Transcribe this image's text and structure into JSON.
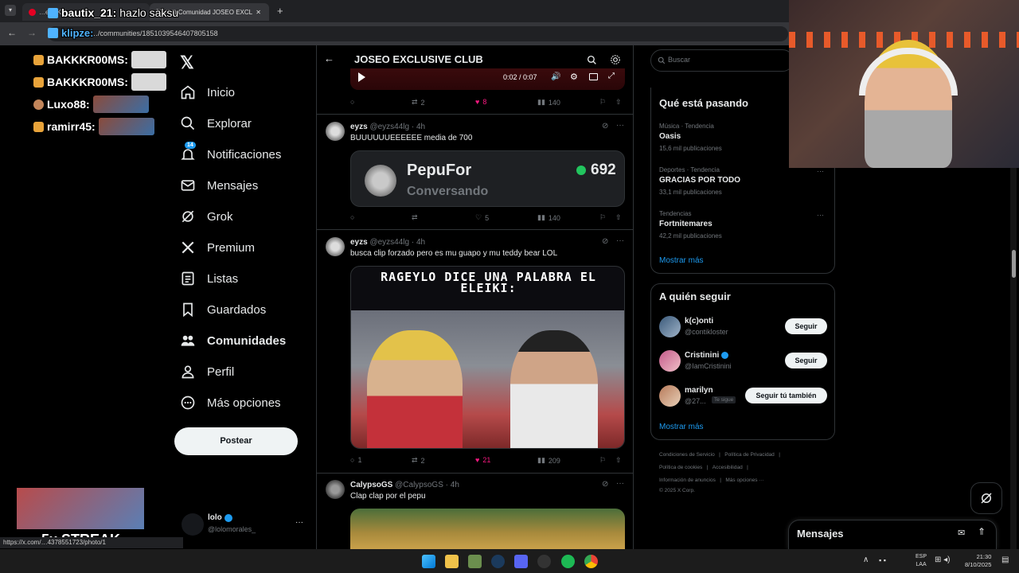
{
  "browser": {
    "tab_overlay_text": "…ello Kitt…",
    "tab_active_label": "(14) Comunidad JOSEO EXCLUS",
    "tab_close": "✕",
    "new_tab": "+",
    "url": "…/communities/1851039546407805158"
  },
  "stream_overlay": {
    "top_message": {
      "user": "bautix_21:",
      "text": "hazlo saksu"
    },
    "url_user": "klipze:",
    "chat": [
      {
        "user": "BAKKKR00MS:",
        "color": "#ffffff"
      },
      {
        "user": "BAKKKR00MS:",
        "color": "#ffffff"
      },
      {
        "user": "Luxo88:",
        "color": "#ffffff"
      },
      {
        "user": "ramirr45:",
        "color": "#ffffff"
      }
    ],
    "streak": "5x STREAK",
    "status_url": "https://x.com/…4378551723/photo/1"
  },
  "sidebar": {
    "items": [
      {
        "label": "Inicio",
        "icon": "home-icon"
      },
      {
        "label": "Explorar",
        "icon": "search-icon"
      },
      {
        "label": "Notificaciones",
        "icon": "bell-icon",
        "badge": "14"
      },
      {
        "label": "Mensajes",
        "icon": "mail-icon"
      },
      {
        "label": "Grok",
        "icon": "grok-icon"
      },
      {
        "label": "Premium",
        "icon": "x-icon"
      },
      {
        "label": "Listas",
        "icon": "list-icon"
      },
      {
        "label": "Guardados",
        "icon": "bookmark-icon"
      },
      {
        "label": "Comunidades",
        "icon": "communities-icon"
      },
      {
        "label": "Perfil",
        "icon": "person-icon"
      },
      {
        "label": "Más opciones",
        "icon": "more-circle-icon"
      }
    ],
    "post_button": "Postear",
    "account": {
      "name": "lolo",
      "handle": "@lolomorales_"
    }
  },
  "header": {
    "title": "JOSEO EXCLUSIVE CLUB"
  },
  "video": {
    "time": "0:02 / 0:07"
  },
  "tweets": [
    {
      "replies": "",
      "retweets": "2",
      "likes": "8",
      "views": "140"
    },
    {
      "name": "eyzs",
      "handle": "@eyzs44lg",
      "time": "· 4h",
      "text": "BUUUUUUEEEEEE media de 700",
      "card": {
        "title": "PepuFor",
        "subtitle": "Conversando",
        "count": "692"
      },
      "replies": "",
      "retweets": "",
      "likes": "5",
      "views": "140"
    },
    {
      "name": "eyzs",
      "handle": "@eyzs44lg",
      "time": "· 4h",
      "text": "busca clip forzado pero es mu guapo y mu teddy bear LOL",
      "image_caption": "RAGEYLO DICE UNA PALABRA EL ELEIKI:",
      "replies": "1",
      "retweets": "2",
      "likes": "21",
      "views": "209"
    },
    {
      "name": "CalypsoGS",
      "handle": "@CalypsoGS",
      "time": "· 4h",
      "text": "Clap clap por el pepu"
    }
  ],
  "right": {
    "search_placeholder": "Buscar",
    "trends_title": "Qué está pasando",
    "trends": [
      {
        "meta": "Música · Tendencia",
        "name": "Oasis",
        "count": "15,6 mil publicaciones"
      },
      {
        "meta": "Deportes · Tendencia",
        "name": "GRACIAS POR TODO",
        "count": "33,1 mil publicaciones"
      },
      {
        "meta": "Tendencias",
        "name": "Fortnitemares",
        "count": "42,2 mil publicaciones"
      }
    ],
    "show_more": "Mostrar más",
    "follow_title": "A quién seguir",
    "follow": [
      {
        "name": "k(c)onti",
        "handle": "@contikloster",
        "button": "Seguir"
      },
      {
        "name": "Cristinini",
        "handle": "@IamCristinini",
        "button": "Seguir"
      },
      {
        "name": "marilyn",
        "handle": "@27...",
        "tag": "Te sigue",
        "button": "Seguir tú también"
      }
    ],
    "show_more_2": "Mostrar más",
    "footer": [
      [
        "Condiciones de Servicio",
        "|",
        "Política de Privacidad",
        "|"
      ],
      [
        "Política de cookies",
        "|",
        "Accesibilidad",
        "|"
      ],
      [
        "Información de anuncios",
        "|",
        "Más opciones ···"
      ],
      [
        "© 2025 X Corp."
      ]
    ],
    "messages_label": "Mensajes"
  },
  "taskbar": {
    "lang": "ESP",
    "lang2": "LAA",
    "time": "21:30",
    "date": "8/10/2025"
  },
  "colors": {
    "accent": "#1d9bf0",
    "like": "#f91880",
    "online": "#22c55e"
  }
}
